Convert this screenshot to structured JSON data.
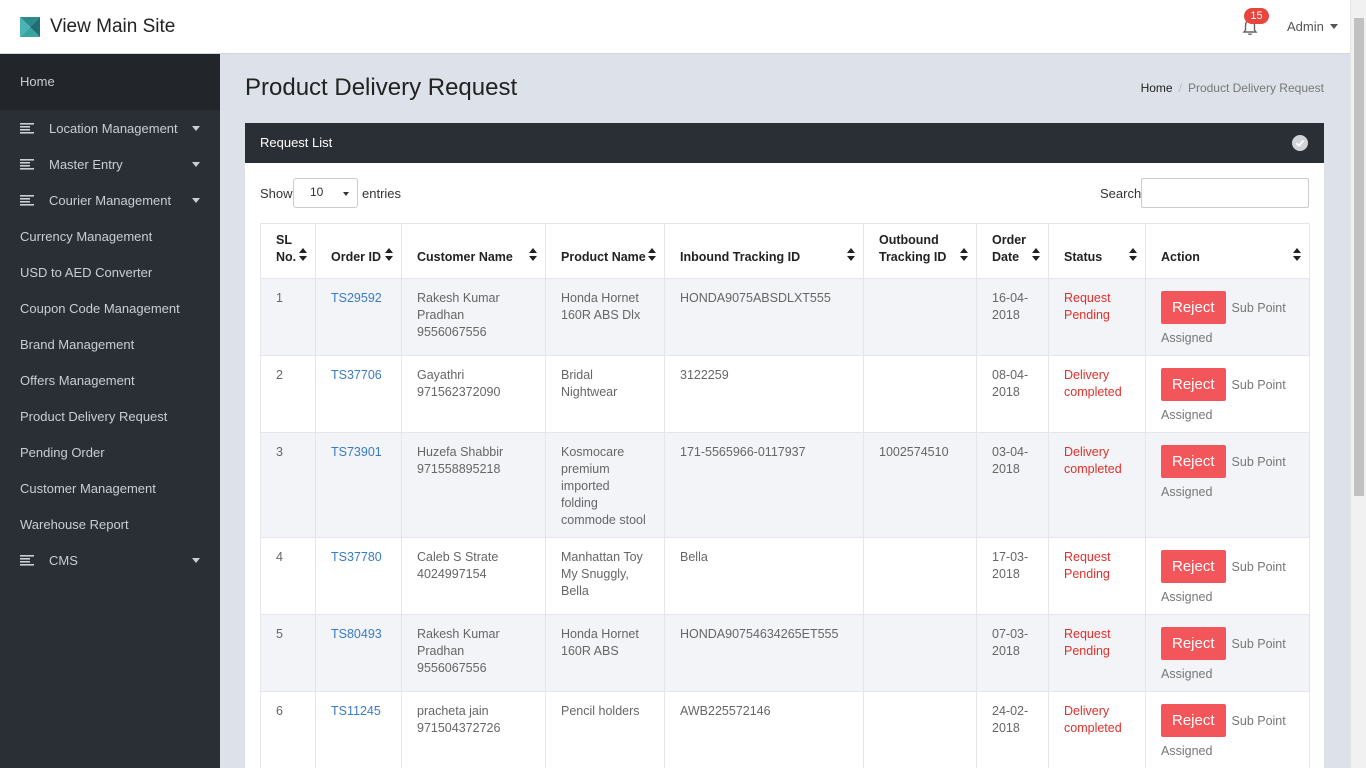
{
  "topbar": {
    "brand": "View Main Site",
    "notification_count": "15",
    "user": "Admin"
  },
  "sidebar": {
    "home": "Home",
    "items": [
      {
        "label": "Location Management",
        "icon": "lines-icon",
        "dropdown": true
      },
      {
        "label": "Master Entry",
        "icon": "lines-icon",
        "dropdown": true
      },
      {
        "label": "Courier Management",
        "icon": "lines-icon",
        "dropdown": true
      },
      {
        "label": "Currency Management"
      },
      {
        "label": "USD to AED Converter"
      },
      {
        "label": "Coupon Code Management"
      },
      {
        "label": "Brand Management"
      },
      {
        "label": "Offers Management"
      },
      {
        "label": "Product Delivery Request"
      },
      {
        "label": "Pending Order"
      },
      {
        "label": "Customer Management"
      },
      {
        "label": "Warehouse Report"
      },
      {
        "label": "CMS",
        "icon": "lines-icon",
        "dropdown": true
      }
    ]
  },
  "page": {
    "title": "Product Delivery Request",
    "breadcrumb_home": "Home",
    "breadcrumb_current": "Product Delivery Request"
  },
  "panel": {
    "title": "Request List",
    "show_label": "Show",
    "page_length": "10",
    "entries_label": "entries",
    "search_label": "Search:"
  },
  "table": {
    "headers": [
      "SL No.",
      "Order ID",
      "Customer Name",
      "Product Name",
      "Inbound Tracking ID",
      "Outbound Tracking ID",
      "Order Date",
      "Status",
      "Action"
    ],
    "reject_label": "Reject",
    "sub_point_label": "Sub Point",
    "assigned_label": "Assigned",
    "rows": [
      {
        "sl": "1",
        "order_id": "TS29592",
        "customer": "Rakesh Kumar Pradhan 9556067556",
        "product": "Honda Hornet 160R ABS Dlx",
        "inbound": "HONDA9075ABSDLXT555",
        "outbound": "",
        "date": "16-04-2018",
        "status": "Request Pending"
      },
      {
        "sl": "2",
        "order_id": "TS37706",
        "customer": "Gayathri 971562372090",
        "product": "Bridal Nightwear",
        "inbound": "3122259",
        "outbound": "",
        "date": "08-04-2018",
        "status": "Delivery completed"
      },
      {
        "sl": "3",
        "order_id": "TS73901",
        "customer": "Huzefa Shabbir 971558895218",
        "product": "Kosmocare premium imported folding commode stool",
        "inbound": "171-5565966-0117937",
        "outbound": "1002574510",
        "date": "03-04-2018",
        "status": "Delivery completed"
      },
      {
        "sl": "4",
        "order_id": "TS37780",
        "customer": "Caleb S Strate 4024997154",
        "product": "Manhattan Toy My Snuggly, Bella",
        "inbound": "Bella",
        "outbound": "",
        "date": "17-03-2018",
        "status": "Request Pending"
      },
      {
        "sl": "5",
        "order_id": "TS80493",
        "customer": "Rakesh Kumar Pradhan 9556067556",
        "product": "Honda Hornet 160R ABS",
        "inbound": "HONDA90754634265ET555",
        "outbound": "",
        "date": "07-03-2018",
        "status": "Request Pending"
      },
      {
        "sl": "6",
        "order_id": "TS11245",
        "customer": "pracheta jain 971504372726",
        "product": "Pencil holders",
        "inbound": "AWB225572146",
        "outbound": "",
        "date": "24-02-2018",
        "status": "Delivery completed"
      }
    ]
  },
  "colors": {
    "sidebar_bg": "#2a2f35",
    "link": "#3a7cc4",
    "status": "#e0302a",
    "reject_button": "#f2555a",
    "badge": "#e8453c"
  }
}
